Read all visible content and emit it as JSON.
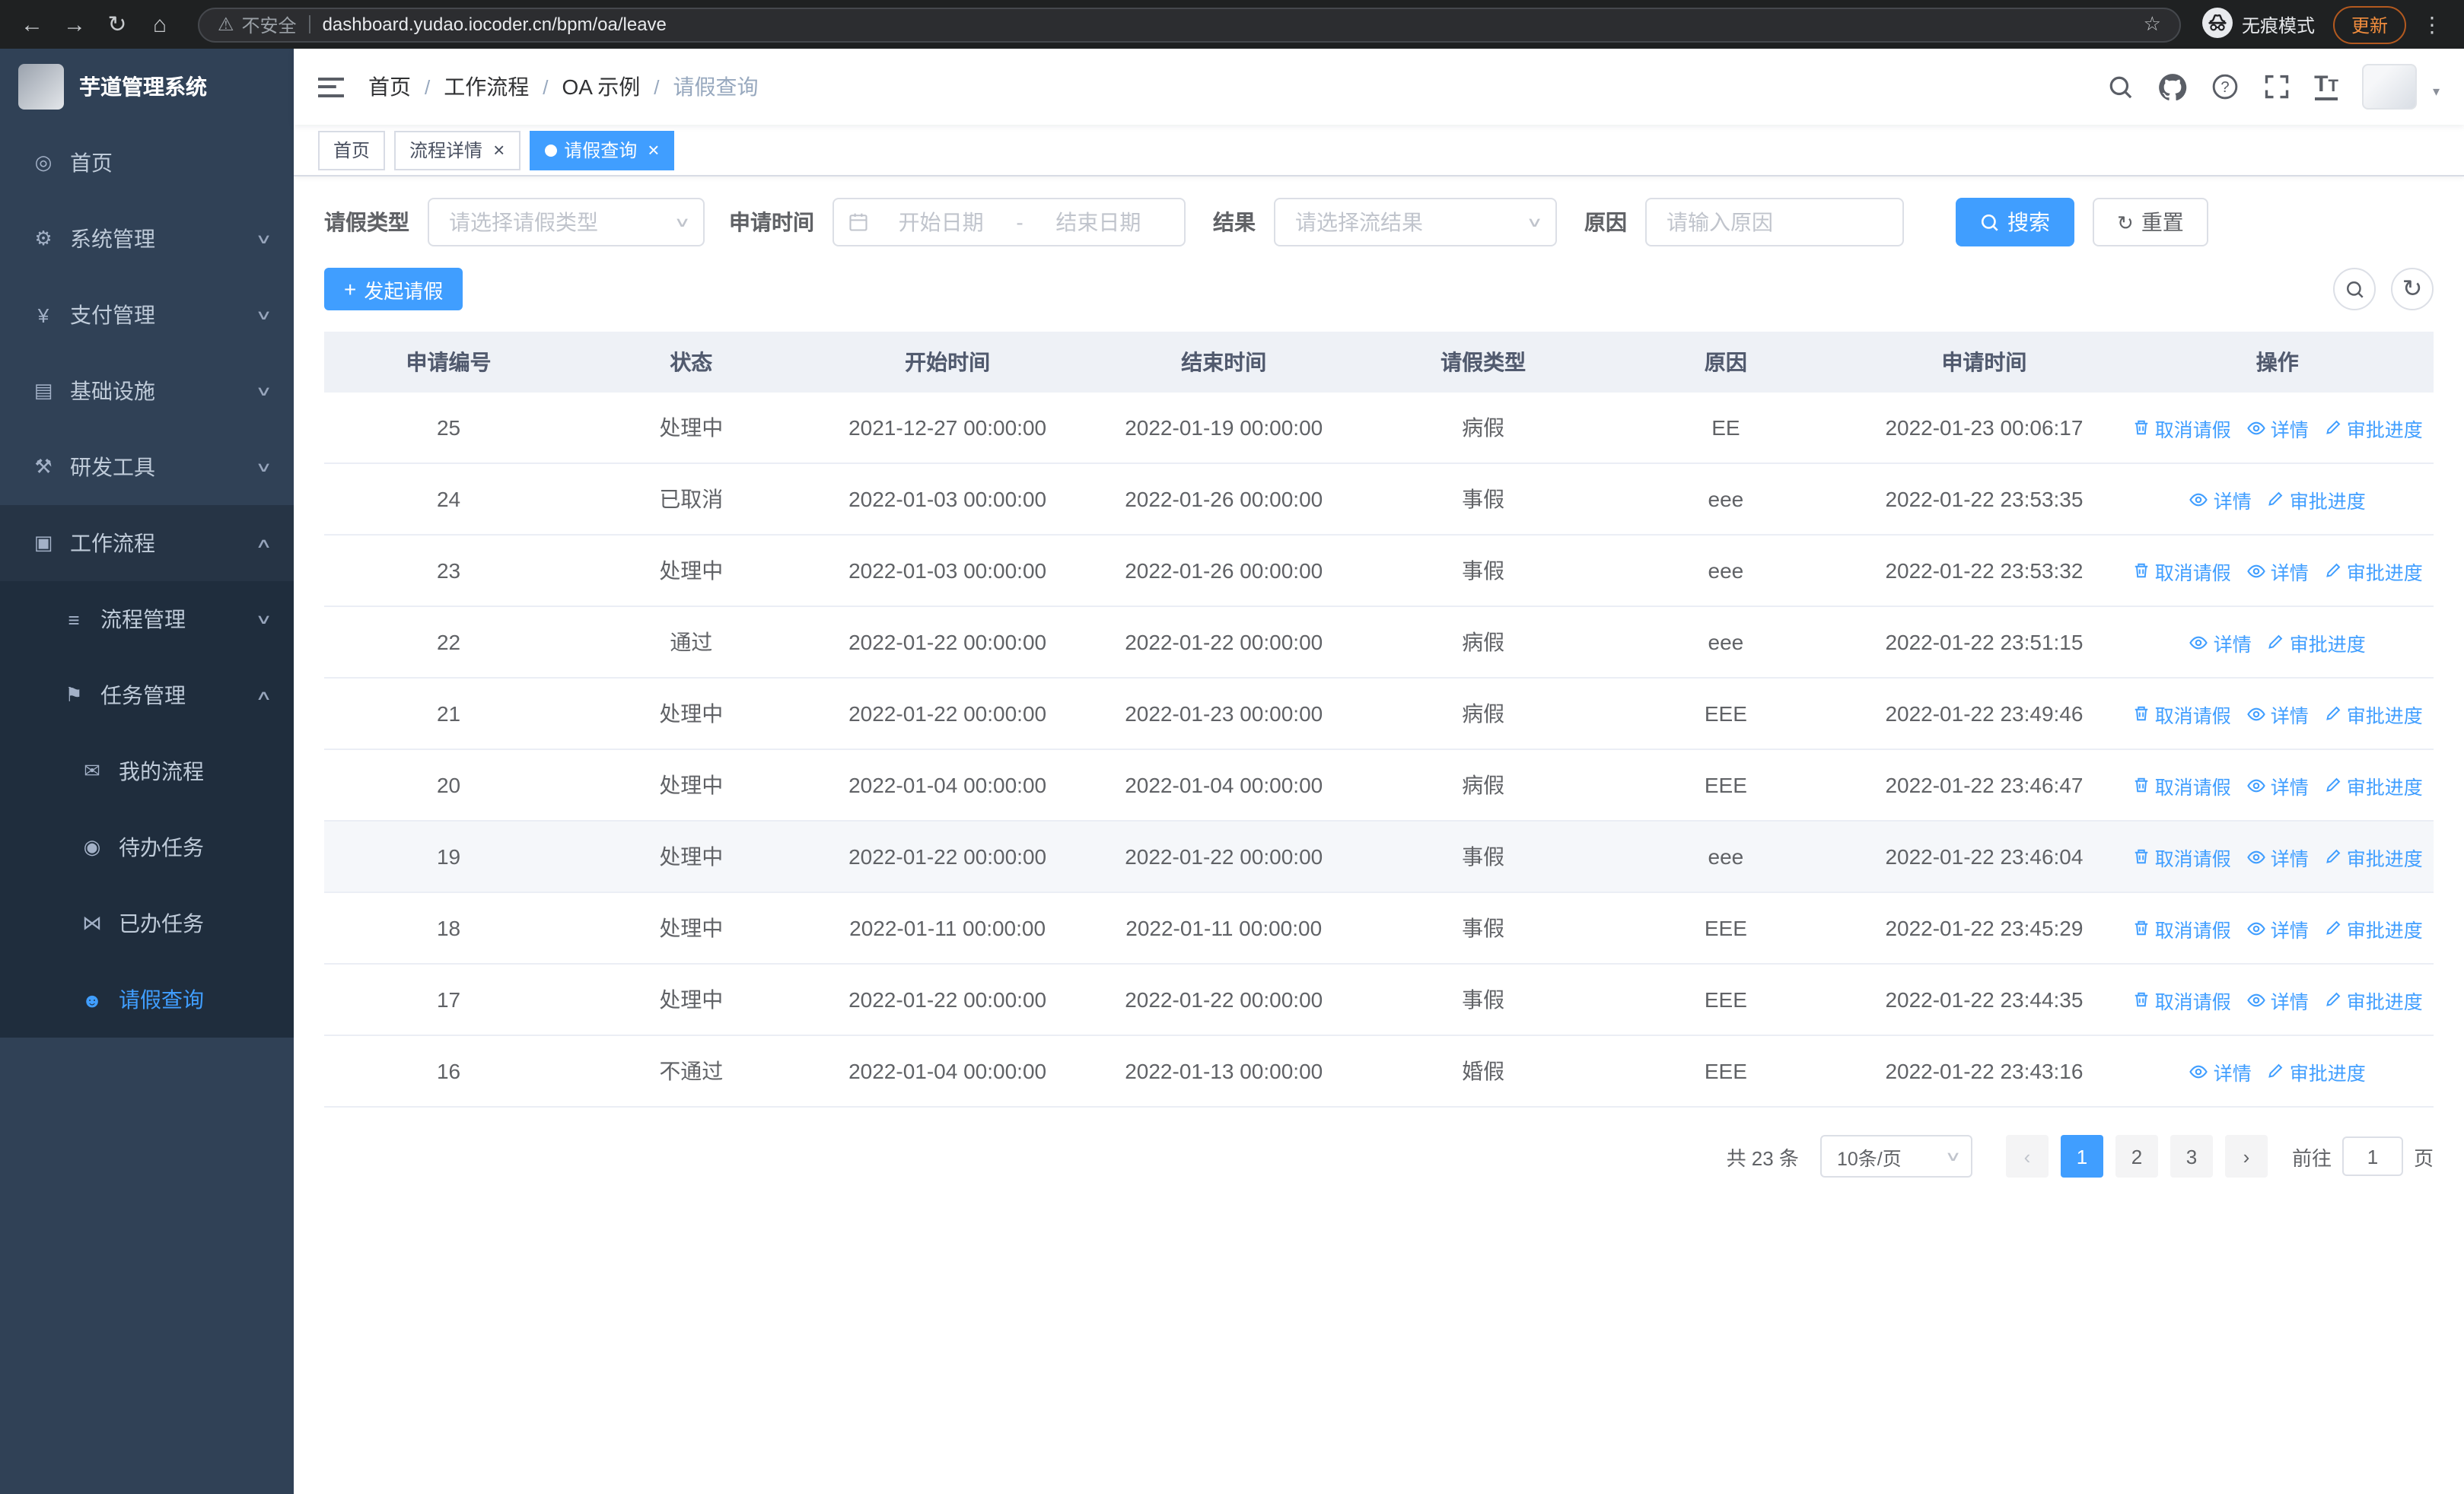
{
  "colors": {
    "primary": "#409eff",
    "sidebar_bg": "#304156",
    "sidebar_sub_bg": "#1f2d3d"
  },
  "glyphs": {
    "back": "←",
    "forward": "→",
    "reload": "↻",
    "home": "⌂",
    "warning": "⚠",
    "star": "☆",
    "dots": "⋮",
    "plus": "+",
    "close": "×",
    "prev": "‹",
    "next": "›",
    "dropdown": "▾"
  },
  "browser": {
    "security_label": "不安全",
    "url": "dashboard.yudao.iocoder.cn/bpm/oa/leave",
    "incognito_label": "无痕模式",
    "update_label": "更新"
  },
  "sidebar": {
    "logo_title": "芋道管理系统",
    "items": [
      {
        "key": "home",
        "label": "首页",
        "icon": "home-icon",
        "level": 1
      },
      {
        "key": "system-management",
        "label": "系统管理",
        "icon": "gear-icon",
        "level": 1,
        "arrow": "down"
      },
      {
        "key": "payment-management",
        "label": "支付管理",
        "icon": "yen-icon",
        "level": 1,
        "arrow": "down"
      },
      {
        "key": "infrastructure",
        "label": "基础设施",
        "icon": "infrastructure-icon",
        "level": 1,
        "arrow": "down"
      },
      {
        "key": "dev-tools",
        "label": "研发工具",
        "icon": "devtools-icon",
        "level": 1,
        "arrow": "down"
      },
      {
        "key": "workflow",
        "label": "工作流程",
        "icon": "workflow-icon",
        "level": 1,
        "arrow": "up",
        "open": true
      },
      {
        "key": "process-management",
        "label": "流程管理",
        "icon": "process-icon",
        "level": 2,
        "sub": true,
        "arrow": "down"
      },
      {
        "key": "task-management",
        "label": "任务管理",
        "icon": "task-icon",
        "level": 2,
        "sub": true,
        "arrow": "up"
      },
      {
        "key": "my-processes",
        "label": "我的流程",
        "icon": "my-process-icon",
        "level": 3,
        "sub": true
      },
      {
        "key": "todo-tasks",
        "label": "待办任务",
        "icon": "todo-eye-icon",
        "level": 3,
        "sub": true
      },
      {
        "key": "done-tasks",
        "label": "已办任务",
        "icon": "done-icon",
        "level": 3,
        "sub": true
      },
      {
        "key": "leave-query",
        "label": "请假查询",
        "icon": "leave-user-icon",
        "level": 3,
        "sub": true,
        "active": true
      }
    ]
  },
  "header": {
    "breadcrumb": [
      "首页",
      "工作流程",
      "OA 示例",
      "请假查询"
    ]
  },
  "tabs": [
    {
      "label": "首页",
      "closable": false,
      "active": false
    },
    {
      "label": "流程详情",
      "closable": true,
      "active": false
    },
    {
      "label": "请假查询",
      "closable": true,
      "active": true
    }
  ],
  "filters": {
    "leave_type_label": "请假类型",
    "leave_type_placeholder": "请选择请假类型",
    "apply_time_label": "申请时间",
    "start_date_placeholder": "开始日期",
    "range_separator": "-",
    "end_date_placeholder": "结束日期",
    "result_label": "结果",
    "result_placeholder": "请选择流结果",
    "reason_label": "原因",
    "reason_placeholder": "请输入原因",
    "search_label": "搜索",
    "reset_label": "重置"
  },
  "toolbar": {
    "create_label": "发起请假"
  },
  "table": {
    "columns": [
      "申请编号",
      "状态",
      "开始时间",
      "结束时间",
      "请假类型",
      "原因",
      "申请时间",
      "操作"
    ],
    "actions": {
      "cancel": "取消请假",
      "detail": "详情",
      "progress": "审批进度"
    },
    "rows": [
      {
        "id": "25",
        "status": "处理中",
        "start": "2021-12-27 00:00:00",
        "end": "2022-01-19 00:00:00",
        "type": "病假",
        "reason": "EE",
        "applied": "2022-01-23 00:06:17",
        "cancelable": true
      },
      {
        "id": "24",
        "status": "已取消",
        "start": "2022-01-03 00:00:00",
        "end": "2022-01-26 00:00:00",
        "type": "事假",
        "reason": "eee",
        "applied": "2022-01-22 23:53:35",
        "cancelable": false
      },
      {
        "id": "23",
        "status": "处理中",
        "start": "2022-01-03 00:00:00",
        "end": "2022-01-26 00:00:00",
        "type": "事假",
        "reason": "eee",
        "applied": "2022-01-22 23:53:32",
        "cancelable": true
      },
      {
        "id": "22",
        "status": "通过",
        "start": "2022-01-22 00:00:00",
        "end": "2022-01-22 00:00:00",
        "type": "病假",
        "reason": "eee",
        "applied": "2022-01-22 23:51:15",
        "cancelable": false
      },
      {
        "id": "21",
        "status": "处理中",
        "start": "2022-01-22 00:00:00",
        "end": "2022-01-23 00:00:00",
        "type": "病假",
        "reason": "EEE",
        "applied": "2022-01-22 23:49:46",
        "cancelable": true
      },
      {
        "id": "20",
        "status": "处理中",
        "start": "2022-01-04 00:00:00",
        "end": "2022-01-04 00:00:00",
        "type": "病假",
        "reason": "EEE",
        "applied": "2022-01-22 23:46:47",
        "cancelable": true
      },
      {
        "id": "19",
        "status": "处理中",
        "start": "2022-01-22 00:00:00",
        "end": "2022-01-22 00:00:00",
        "type": "事假",
        "reason": "eee",
        "applied": "2022-01-22 23:46:04",
        "cancelable": true,
        "highlighted": true
      },
      {
        "id": "18",
        "status": "处理中",
        "start": "2022-01-11 00:00:00",
        "end": "2022-01-11 00:00:00",
        "type": "事假",
        "reason": "EEE",
        "applied": "2022-01-22 23:45:29",
        "cancelable": true
      },
      {
        "id": "17",
        "status": "处理中",
        "start": "2022-01-22 00:00:00",
        "end": "2022-01-22 00:00:00",
        "type": "事假",
        "reason": "EEE",
        "applied": "2022-01-22 23:44:35",
        "cancelable": true
      },
      {
        "id": "16",
        "status": "不通过",
        "start": "2022-01-04 00:00:00",
        "end": "2022-01-13 00:00:00",
        "type": "婚假",
        "reason": "EEE",
        "applied": "2022-01-22 23:43:16",
        "cancelable": false
      }
    ]
  },
  "pagination": {
    "total_label": "共 23 条",
    "page_size_label": "10条/页",
    "pages": [
      "1",
      "2",
      "3"
    ],
    "active_page": "1",
    "goto_label": "前往",
    "goto_value": "1",
    "goto_suffix": "页"
  }
}
